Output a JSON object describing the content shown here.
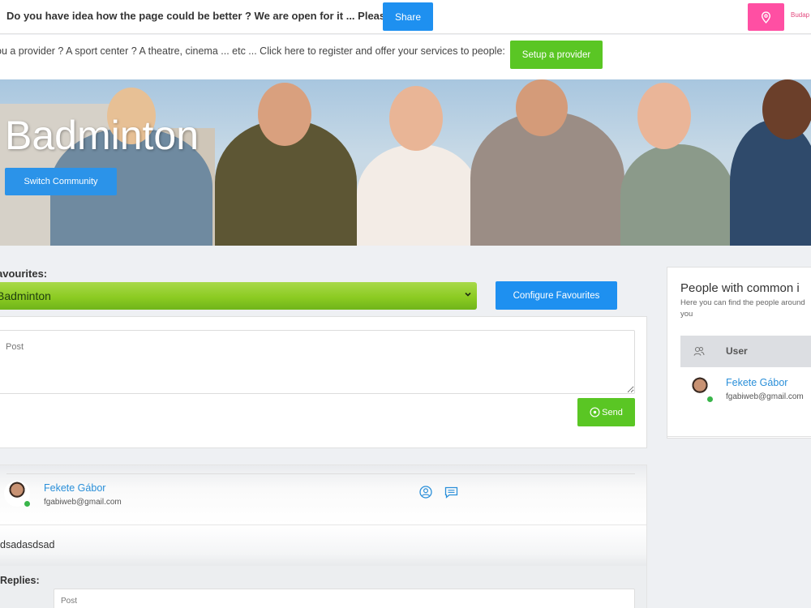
{
  "topbar": {
    "feedback_message": "Do you have idea how the page could be better ? We are open for it ... Please",
    "share_label": "Share",
    "location_icon": "location-pin-icon",
    "location_text": "Budap"
  },
  "provider_bar": {
    "text": "ou a provider ? A sport center ? A theatre, cinema ... etc ... Click here to register and offer your services to people:",
    "setup_label": "Setup a provider"
  },
  "hero": {
    "title": "Badminton",
    "switch_label": "Switch Community"
  },
  "favourites": {
    "label": "avourites:",
    "selected": "Badminton",
    "configure_label": "Configure Favourites"
  },
  "post_composer": {
    "placeholder": "Post",
    "send_label": "Send",
    "send_icon": "send-circle-icon"
  },
  "feed": {
    "post": {
      "author": "Fekete Gábor",
      "email": "fgabiweb@gmail.com",
      "body": "dsadasdsad",
      "profile_icon": "user-circle-icon",
      "message_icon": "message-icon"
    },
    "replies_label": "Replies:",
    "reply_placeholder": "Post"
  },
  "common_people": {
    "title": "People with common i",
    "subtitle": "Here you can find the people around you",
    "column_header": "User",
    "column_icon": "users-icon",
    "users": [
      {
        "name": "Fekete Gábor",
        "email": "fgabiweb@gmail.com",
        "online": true
      }
    ]
  },
  "colors": {
    "primary_blue": "#1e90f0",
    "success_green": "#5ac624",
    "location_pink": "#ff4fa3",
    "link_blue": "#2a8fd9",
    "online_green": "#39b54a"
  }
}
